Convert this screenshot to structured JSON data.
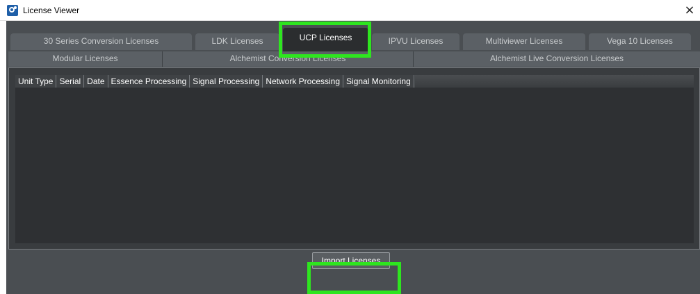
{
  "window": {
    "title": "License Viewer",
    "close_glyph": "×",
    "app_icon": "license-viewer-app-icon"
  },
  "tabs": {
    "row1": [
      {
        "label": "30 Series Conversion Licenses"
      },
      {
        "label": "LDK Licenses"
      },
      {
        "label": "UCP Licenses",
        "active": true
      },
      {
        "label": "IPVU Licenses"
      },
      {
        "label": "Multiviewer Licenses"
      },
      {
        "label": "Vega 10 Licenses"
      }
    ],
    "row2": [
      {
        "label": "Modular Licenses"
      },
      {
        "label": "Alchemist Conversion Licenses"
      },
      {
        "label": "Alchemist Live Conversion Licenses"
      }
    ]
  },
  "table": {
    "columns": [
      "Unit Type",
      "Serial",
      "Date",
      "Essence Processing",
      "Signal Processing",
      "Network Processing",
      "Signal Monitoring"
    ],
    "rows": []
  },
  "buttons": {
    "import_label": "Import Licenses"
  },
  "colors": {
    "highlight": "#2ee51f",
    "background": "#4a4e52",
    "active_tab": "#2b2d2f"
  }
}
